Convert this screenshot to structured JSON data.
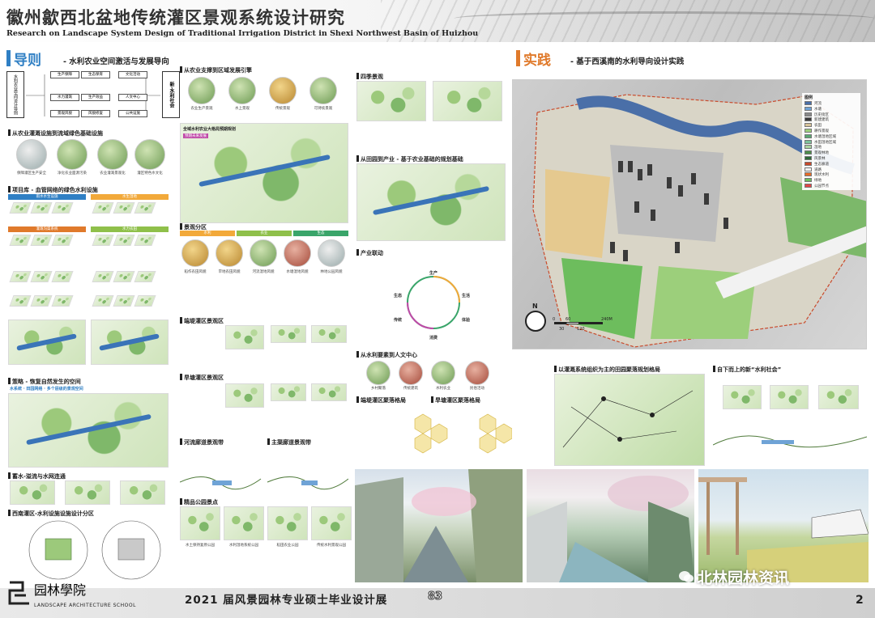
{
  "header": {
    "title_cn": "徽州歙西北盆地传统灌区景观系统设计研究",
    "title_en": "Research on Landscape System Design of Traditional Irrigation District in Shexi Northwest Basin of Huizhou"
  },
  "guide": {
    "title": "导则",
    "subtitle": "- 水利农业空间激活与发展导向",
    "flow_left": "水利农业空间设计导则",
    "flow_right": "新·水利社会",
    "flow_boxes": [
      "生产保障",
      "水力灌溉",
      "景观风貌",
      "生态保育",
      "生产效益",
      "风貌修复",
      "文化活动",
      "人文中心",
      "公共设施",
      "社会合作"
    ],
    "section1": "从农业灌溉设施到流域绿色基础设施",
    "infra_captions": [
      "保障灌区生产安全",
      "净化农业面源污染",
      "农业灌溉景观化",
      "灌区特色水文化"
    ],
    "project_lib": "项目库 - 血管网络的绿色水利设施",
    "col_labels": [
      "雨水水生设施",
      "水生湿地",
      "灌溉沟渠系统",
      "水力农田"
    ],
    "strategy_title": "策略 - 恢复自然发生的空间",
    "strategy_sub": "水系统 · 田园网络 · 多个层级的景观空间",
    "section_eco": "蓄水-溢流与水网连通",
    "section_wet": "西南灌区-水利设施设施设计分区"
  },
  "middle": {
    "section2": "从农业支撑到区域发展引擎",
    "engine_captions": [
      "农业生产景观",
      "水上景观",
      "传统景观",
      "可持续景观"
    ],
    "network_title": "全域水利农业大格局预期规划",
    "network_tag": "预期未来发展",
    "zone_title": "景观分区",
    "zone_bars": [
      "水利",
      "农业",
      "生态"
    ],
    "zone_captions": [
      "稻作农田风貌",
      "旱地农田风貌",
      "河流湿地风貌",
      "水塘湿地风貌",
      "林地公园风貌"
    ],
    "zone_sub1": "端堤灌区景观区",
    "zone_sub2": "旱塘灌区景观区",
    "node_title1": "河流廊道景观带",
    "node_title2": "主渠廊道景观带",
    "park_title": "精品公园景点",
    "park_captions": [
      "水土保持复原公园",
      "水利湿地系统公园",
      "稻田农业公园",
      "传统水利景观公园"
    ],
    "season_title": "四季景观",
    "industry_title": "从田园到产业 - 基于农业基础的规划基础",
    "industry_cycle": "产业联动",
    "cycle_labels": [
      "生产",
      "生活",
      "体验",
      "消费",
      "传统",
      "生态"
    ],
    "humanity_title": "从水利要素到人文中心",
    "humanity_captions": [
      "乡村聚落",
      "传统建筑",
      "水利农业",
      "民俗活动"
    ],
    "hex_title1": "端堤灌区聚落格局",
    "hex_title2": "旱塘灌区聚落格局"
  },
  "practice": {
    "title": "实践",
    "subtitle": "- 基于西溪南的水利导向设计实践",
    "legend_title": "图例",
    "legend": [
      {
        "label": "河流",
        "color": "#4a6fa8"
      },
      {
        "label": "水塘",
        "color": "#6fa3d6"
      },
      {
        "label": "历史街区",
        "color": "#8a8a8a"
      },
      {
        "label": "新建建筑",
        "color": "#3a3a3a"
      },
      {
        "label": "农田",
        "color": "#d8c49a"
      },
      {
        "label": "耕作景观",
        "color": "#9ccf7b"
      },
      {
        "label": "水塘湿地区域",
        "color": "#58a870"
      },
      {
        "label": "水田湿地区域",
        "color": "#7cc29b"
      },
      {
        "label": "湿地",
        "color": "#a8d4a0"
      },
      {
        "label": "景观林地",
        "color": "#4d8d4a"
      },
      {
        "label": "风景林",
        "color": "#2e6a39"
      },
      {
        "label": "生态廊道",
        "color": "#c94a2b"
      },
      {
        "label": "道路",
        "color": "#f2f2f2"
      },
      {
        "label": "现状水利",
        "color": "#e86d28"
      },
      {
        "label": "绿地",
        "color": "#6dbd5d"
      },
      {
        "label": "公园节点",
        "color": "#e24646"
      }
    ],
    "north": "N",
    "scale_ticks": [
      "0",
      "30",
      "60",
      "120",
      "240M"
    ],
    "sub_title1": "以灌溉系统组织为主的田园聚落规划格局",
    "sub_title2": "自下而上的新“水利社会”"
  },
  "footer": {
    "logo_cn": "园林學院",
    "logo_en": "LANDSCAPE ARCHITECTURE SCHOOL",
    "exhibit_title": "2021 届风景园林专业硕士毕业设计展",
    "exhibit_num": "83",
    "page_num": "2",
    "watermark": "北林园林资讯"
  },
  "colors": {
    "guide_accent": "#2f7fc4",
    "practice_accent": "#e07a2b",
    "zone_water": "#f2a93a",
    "zone_farm": "#8fc04a",
    "zone_eco": "#3aa56a"
  }
}
